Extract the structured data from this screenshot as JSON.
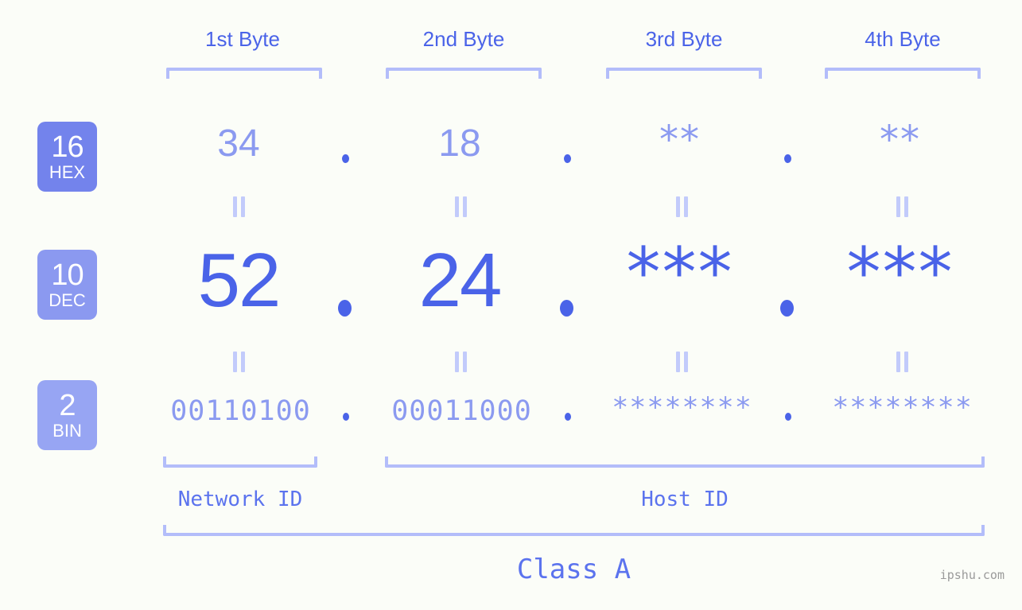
{
  "page": {
    "background": "#fbfdf8",
    "accent_strong": "#4a63e8",
    "accent_light": "#8b9af0",
    "bracket_color": "#b3bdfa",
    "watermark": "ipshu.com"
  },
  "byte_headers": [
    {
      "label": "1st Byte"
    },
    {
      "label": "2nd Byte"
    },
    {
      "label": "3rd Byte"
    },
    {
      "label": "4th Byte"
    }
  ],
  "bases": [
    {
      "number": "16",
      "name": "HEX",
      "color": "#7383ec"
    },
    {
      "number": "10",
      "name": "DEC",
      "color": "#8b99f0"
    },
    {
      "number": "2",
      "name": "BIN",
      "color": "#97a5f3"
    }
  ],
  "rows": {
    "hex": {
      "base_number": "16",
      "base_name": "HEX",
      "values": [
        "34",
        "18",
        "**",
        "**"
      ],
      "separator": "."
    },
    "dec": {
      "base_number": "10",
      "base_name": "DEC",
      "values": [
        "52",
        "24",
        "***",
        "***"
      ],
      "separator": "."
    },
    "bin": {
      "base_number": "2",
      "base_name": "BIN",
      "values": [
        "00110100",
        "00011000",
        "********",
        "********"
      ],
      "separator": "."
    }
  },
  "equals_symbol": "=",
  "id_sections": [
    {
      "label": "Network ID"
    },
    {
      "label": "Host ID"
    }
  ],
  "class_label": "Class A"
}
